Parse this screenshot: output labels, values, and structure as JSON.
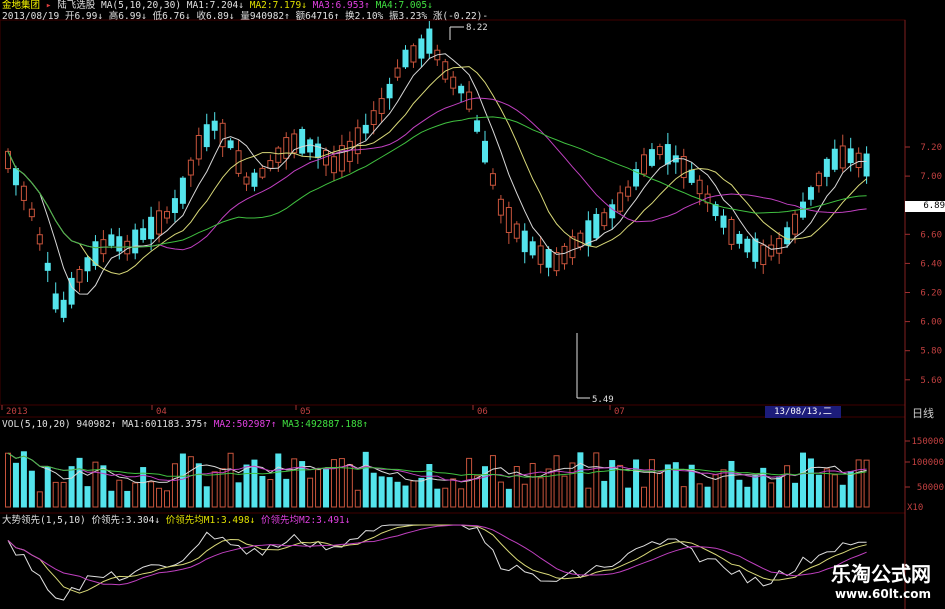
{
  "colors": {
    "background": "#000000",
    "up": "#c8543c",
    "down": "#54e4ec",
    "ma1": "#d8d8d8",
    "ma2": "#d8d878",
    "ma3": "#c040c0",
    "ma4": "#40c040",
    "grid": "#400000"
  },
  "header": {
    "stock_name": "金地集团",
    "indicator_name": "陆飞选股",
    "ma_params": "MA(5,10,20,30)",
    "ma1": "MA1:7.204↓",
    "ma2": "MA2:7.179↓",
    "ma3": "MA3:6.953↑",
    "ma4": "MA4:7.005↓",
    "date": "2013/08/19",
    "open": "开6.99↓",
    "high": "高6.99↓",
    "low": "低6.76↓",
    "close": "收6.89↓",
    "volume": "量940982↑",
    "amount": "额64716↑",
    "turnover": "换2.10%",
    "amplitude": "振3.23%",
    "change": "涨(-0.22)-"
  },
  "price_axis": {
    "ticks": [
      "7.20",
      "7.00",
      "6.80",
      "6.60",
      "6.40",
      "6.20",
      "6.00",
      "5.80",
      "5.60"
    ],
    "current": "6.89",
    "high_marker": "8.22",
    "low_marker": "5.49"
  },
  "time_axis": {
    "labels": [
      "2013",
      "04",
      "05",
      "06",
      "07"
    ],
    "cursor_date": "13/08/13,二",
    "period": "日线"
  },
  "volume_panel": {
    "title": "VOL(5,10,20)",
    "value": "940982↑",
    "ma1": "MA1:601183.375↑",
    "ma2": "MA2:502987↑",
    "ma3": "MA3:492887.188↑",
    "ticks": [
      "150000",
      "100000",
      "50000"
    ],
    "unit": "X10"
  },
  "indicator_panel": {
    "title": "大势领先(1,5,10)",
    "lead": "价领先:3.304↓",
    "lead_ma1": "价领先均M1:3.498↓",
    "lead_ma2": "价领先均M2:3.491↓"
  },
  "watermark": {
    "name": "乐淘公式网",
    "url": "www.60lt.com"
  }
}
